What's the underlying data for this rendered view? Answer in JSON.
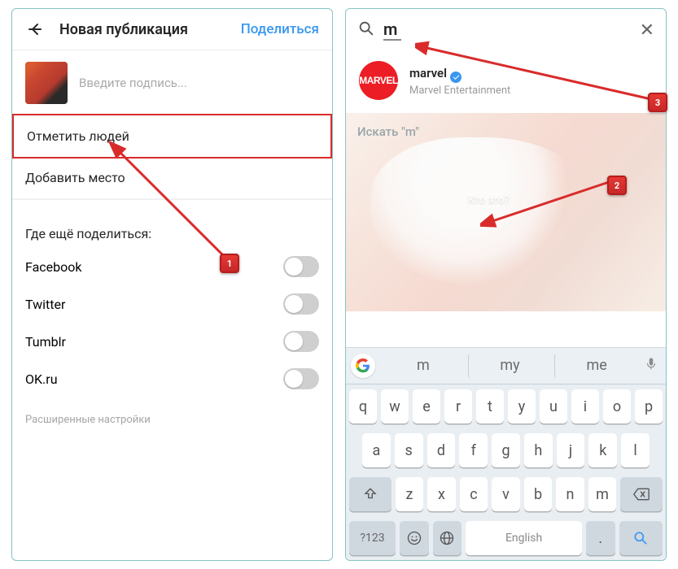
{
  "left": {
    "title": "Новая публикация",
    "share_action": "Поделиться",
    "caption_placeholder": "Введите подпись...",
    "tag_people": "Отметить людей",
    "add_location": "Добавить место",
    "also_share": "Где ещё поделиться:",
    "networks": [
      {
        "name": "Facebook",
        "on": false
      },
      {
        "name": "Twitter",
        "on": false
      },
      {
        "name": "Tumblr",
        "on": false
      },
      {
        "name": "OK.ru",
        "on": false
      }
    ],
    "advanced": "Расширенные настройки"
  },
  "right": {
    "search_value": "m",
    "result_username": "marvel",
    "result_fullname": "Marvel Entertainment",
    "result_avatar_text": "MARVEL",
    "hint": "Искать \"m\"",
    "tag_prompt": "Кто это?",
    "suggestions": [
      "m",
      "my",
      "me"
    ],
    "keyboard": {
      "row1": [
        "q",
        "w",
        "e",
        "r",
        "t",
        "y",
        "u",
        "i",
        "o",
        "p"
      ],
      "row2": [
        "a",
        "s",
        "d",
        "f",
        "g",
        "h",
        "j",
        "k",
        "l"
      ],
      "row3": [
        "z",
        "x",
        "c",
        "v",
        "b",
        "n",
        "m"
      ],
      "num_key": "?123",
      "lang": "English"
    }
  },
  "annotations": {
    "a1": "1",
    "a2": "2",
    "a3": "3"
  }
}
